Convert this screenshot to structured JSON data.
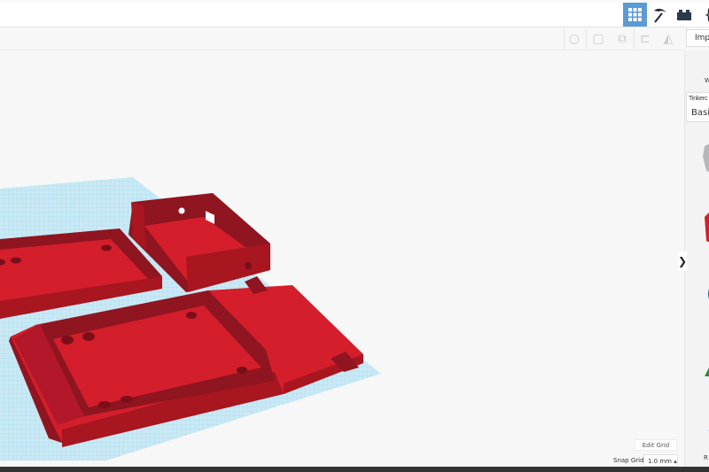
{
  "topbar": {
    "icons": [
      "grid-view-icon",
      "pickaxe-icon",
      "bricks-icon",
      "codeblocks-icon"
    ],
    "active": "grid-view-icon",
    "accent": "#5b9bd5"
  },
  "toolbar": {
    "tools": [
      "light-bulb-icon",
      "group-icon",
      "ungroup-icon",
      "align-icon",
      "mirror-icon"
    ],
    "import_label": "Impo"
  },
  "sidebar": {
    "label": "W",
    "library_heading": "Tinkerc",
    "library_value": "Basic",
    "bottom_label": "R",
    "collapse": "❯"
  },
  "workplane": {
    "edit_grid_label": "Edit Grid",
    "snap_grid_label": "Snap Grid",
    "snap_grid_value": "1.0 mm ▴"
  },
  "colors": {
    "shape_red": "#d41e2c",
    "grid": "#bfe4f2"
  }
}
